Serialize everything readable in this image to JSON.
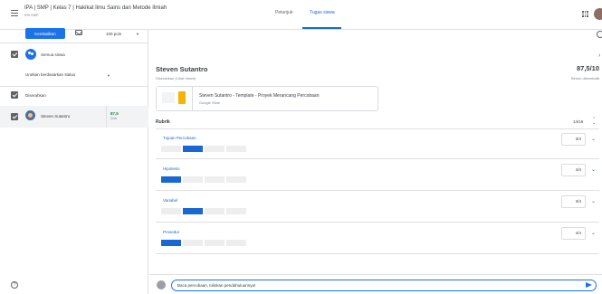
{
  "header": {
    "course_title": "IPA | SMP | Kelas 7 | Hakikat Ilmu Sains dan Metode Ilmiah",
    "course_sub": "IPA SMP",
    "tabs": [
      {
        "label": "Petunjuk"
      },
      {
        "label": "Tugas siswa"
      }
    ],
    "active_tab": "Tugas siswa"
  },
  "left": {
    "return_button": "Kembalikan",
    "points": "100 poin",
    "all_students": "Semua siswa",
    "sort_label": "Urutkan berdasarkan status",
    "section_label": "Diserahkan",
    "students": [
      {
        "name": "Steven Sutantro",
        "grade": "87,5",
        "draft": "Draf"
      }
    ]
  },
  "right": {
    "student_name": "Steven Sutantro",
    "status": "Diserahkan (Lihat histori)",
    "score": "87,5/10",
    "score_status": "Belum dikembalik",
    "attachment": {
      "title": "Steven Sutantro - Template - Proyek Merancang Percobaan",
      "type": "Google Slide"
    },
    "rubric": {
      "label": "Rubrik",
      "total": "14/16",
      "criteria": [
        {
          "name": "Tujuan Percobaan",
          "score": "3/4",
          "levels": 4,
          "selected": 2
        },
        {
          "name": "Hipotesis",
          "score": "4/4",
          "levels": 4,
          "selected": 1
        },
        {
          "name": "Variabel",
          "score": "3/4",
          "levels": 4,
          "selected": 2
        },
        {
          "name": "Prosedur",
          "score": "4/4",
          "levels": 4,
          "selected": 1
        }
      ]
    },
    "comment_value": "Baca percobaan, tuliskan pendahuluannya!"
  },
  "colors": {
    "accent": "#1a73e8",
    "tab_active": "#1967d2",
    "grade": "#188038",
    "level_off": "#eeeeee"
  }
}
